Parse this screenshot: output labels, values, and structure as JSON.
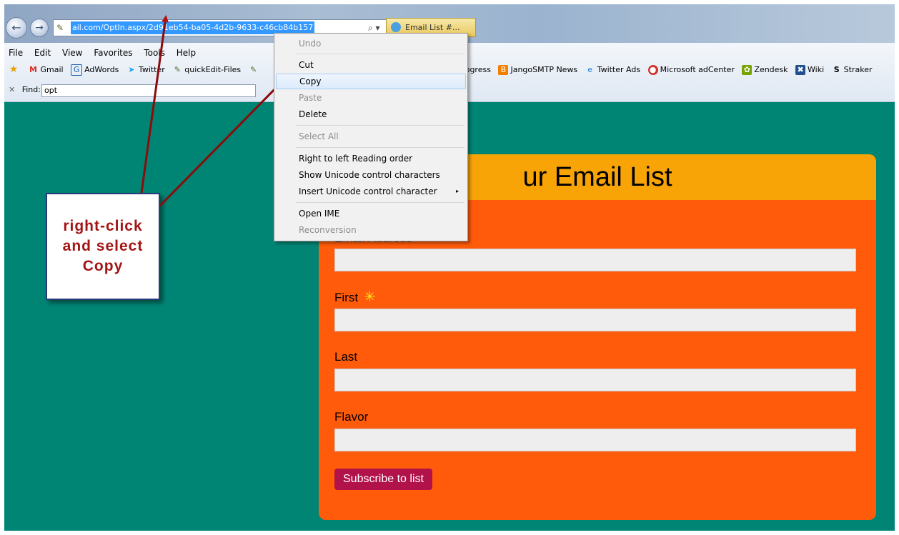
{
  "browser": {
    "address_url": "ail.com/OptIn.aspx/2d91eb54-ba05-4d2b-9633-c46cb84b157",
    "address_controls": "⌕ ▾ 🔒 ↻ ✕",
    "tab_label": "Email List #..."
  },
  "menubar": {
    "items": [
      "File",
      "Edit",
      "View",
      "Favorites",
      "Tools",
      "Help"
    ]
  },
  "favorites": {
    "left": [
      {
        "label": "Gmail",
        "icon": "gmail-icon"
      },
      {
        "label": "AdWords",
        "icon": "adwords-icon"
      },
      {
        "label": "Twitter",
        "icon": "twitter-icon"
      },
      {
        "label": "quickEdit-Files",
        "icon": "pen-icon"
      }
    ],
    "right": [
      {
        "label": "Progress",
        "icon": ""
      },
      {
        "label": "JangoSMTP News",
        "icon": "blogger-icon"
      },
      {
        "label": "Twitter Ads",
        "icon": "ie-icon"
      },
      {
        "label": "Microsoft adCenter",
        "icon": "adcenter-icon"
      },
      {
        "label": "Zendesk",
        "icon": "zendesk-icon"
      },
      {
        "label": "Wiki",
        "icon": "wiki-icon"
      },
      {
        "label": "Straker",
        "icon": "straker-icon"
      }
    ]
  },
  "findbar": {
    "close_glyph": "✕",
    "label": "Find:",
    "value": "opt"
  },
  "form": {
    "title": "ur Email List",
    "email_label": "Email Address",
    "first_label": "First",
    "first_required": "✳",
    "last_label": "Last",
    "flavor_label": "Flavor",
    "submit_label": "Subscribe to list"
  },
  "callout": {
    "text": "right-click\nand select\nCopy"
  },
  "context_menu": {
    "items": [
      {
        "label": "Undo",
        "disabled": true
      },
      {
        "label": "Cut",
        "disabled": false
      },
      {
        "label": "Copy",
        "disabled": false,
        "highlighted": true
      },
      {
        "label": "Paste",
        "disabled": true
      },
      {
        "label": "Delete",
        "disabled": false
      },
      {
        "label": "Select All",
        "disabled": true
      },
      {
        "label": "Right to left Reading order",
        "disabled": false
      },
      {
        "label": "Show Unicode control characters",
        "disabled": false
      },
      {
        "label": "Insert Unicode control character",
        "disabled": false,
        "submenu": "▸"
      },
      {
        "label": "Open IME",
        "disabled": false
      },
      {
        "label": "Reconversion",
        "disabled": true
      }
    ]
  },
  "colors": {
    "page_bg": "#008574",
    "card_bg": "#ff5b0a",
    "card_header": "#f8a406",
    "button": "#b2124a",
    "arrow": "#b01010"
  }
}
